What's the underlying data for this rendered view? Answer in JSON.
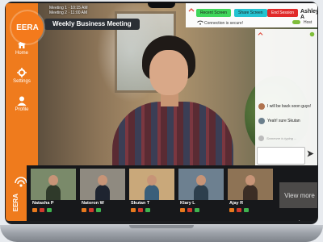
{
  "app": {
    "brand": "EERA",
    "brand_vertical": "EERA"
  },
  "sidebar": {
    "items": [
      {
        "label": "Home",
        "icon": "home-icon"
      },
      {
        "label": "Settings",
        "icon": "gear-icon"
      },
      {
        "label": "Profile",
        "icon": "user-icon"
      }
    ]
  },
  "meeting": {
    "line1": "Meeting 1 · 10:15 AM",
    "line2": "Meeting 2 · 11:00 AM",
    "title": "Weekly Business Meeting"
  },
  "controls": {
    "recent_screen": "Recent Screen",
    "share_screen": "Share Screen",
    "end_session": "End Session",
    "username": "Ashley A",
    "connection": "Connection is secure!",
    "host": "Host"
  },
  "chat": {
    "messages": [
      {
        "text": "I will be back soon guys!",
        "color": "#b0734f"
      },
      {
        "text": "Yeah! sure Skutan",
        "color": "#6b7f8c"
      }
    ],
    "typing": "Someone is typing ...",
    "input_placeholder": ""
  },
  "participants": [
    {
      "name": "Natasha P",
      "bg": "#7a8a6a",
      "body": "#2f3a2a"
    },
    {
      "name": "Natoron W",
      "bg": "#8f8a80",
      "body": "#1e2430"
    },
    {
      "name": "Skutan T",
      "bg": "#c9a87a",
      "body": "#3a5f7a"
    },
    {
      "name": "Klary L",
      "bg": "#6d8090",
      "body": "#2d3f4d"
    },
    {
      "name": "Ajay R",
      "bg": "#8e7355",
      "body": "#3b2d25"
    }
  ],
  "view_more": "View more ›",
  "colors": {
    "sidebar": "#ef7b1d",
    "recent_screen_btn": "#3fd65c",
    "share_screen_btn": "#23c3d1",
    "end_session_btn": "#e12a2a"
  }
}
